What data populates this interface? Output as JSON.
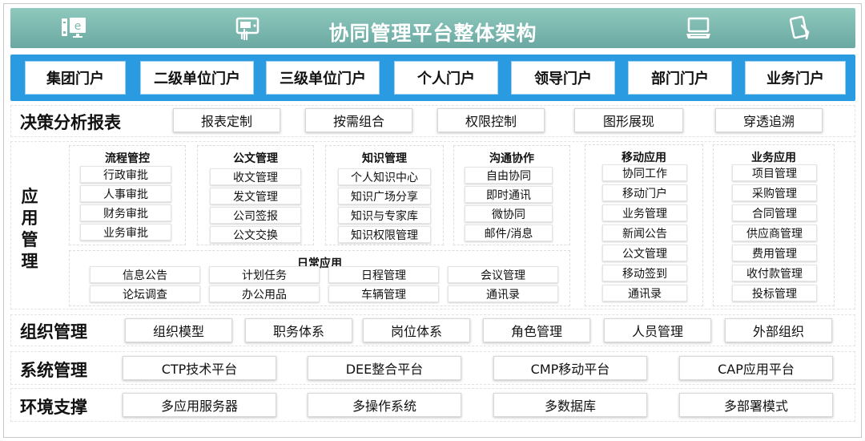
{
  "header": {
    "title": "协同管理平台整体架构",
    "bg_color": "#7db8b0",
    "icons": [
      "computer-e-icon",
      "touch-tablet-icon",
      "laptop-icon",
      "mobile-touch-icon"
    ]
  },
  "portals": {
    "bg_color": "#2a9be0",
    "items": [
      "集团门户",
      "二级单位门户",
      "三级单位门户",
      "个人门户",
      "领导门户",
      "部门门户",
      "业务门户"
    ]
  },
  "decision": {
    "label": "决策分析报表",
    "items": [
      "报表定制",
      "按需组合",
      "权限控制",
      "图形展现",
      "穿透追溯"
    ]
  },
  "apps": {
    "label": [
      "应",
      "用",
      "管",
      "理"
    ],
    "groups": [
      {
        "title": "流程管控",
        "items": [
          "行政审批",
          "人事审批",
          "财务审批",
          "业务审批"
        ]
      },
      {
        "title": "公文管理",
        "items": [
          "收文管理",
          "发文管理",
          "公司签报",
          "公文交换"
        ]
      },
      {
        "title": "知识管理",
        "items": [
          "个人知识中心",
          "知识广场分享",
          "知识与专家库",
          "知识权限管理"
        ]
      },
      {
        "title": "沟通协作",
        "items": [
          "自由协同",
          "即时通讯",
          "微协同",
          "邮件/消息"
        ]
      },
      {
        "title": "移动应用",
        "items": [
          "协同工作",
          "移动门户",
          "业务管理",
          "新闻公告",
          "公文管理",
          "移动签到",
          "通讯录"
        ]
      },
      {
        "title": "业务应用",
        "items": [
          "项目管理",
          "采购管理",
          "合同管理",
          "供应商管理",
          "费用管理",
          "收付款管理",
          "投标管理"
        ]
      }
    ],
    "daily": {
      "title": "日常应用",
      "items": [
        "信息公告",
        "计划任务",
        "日程管理",
        "会议管理",
        "论坛调查",
        "办公用品",
        "车辆管理",
        "通讯录"
      ]
    }
  },
  "org": {
    "label": "组织管理",
    "items": [
      "组织模型",
      "职务体系",
      "岗位体系",
      "角色管理",
      "人员管理",
      "外部组织"
    ]
  },
  "system": {
    "label": "系统管理",
    "items": [
      "CTP技术平台",
      "DEE整合平台",
      "CMP移动平台",
      "CAP应用平台"
    ]
  },
  "env": {
    "label": "环境支撑",
    "items": [
      "多应用服务器",
      "多操作系统",
      "多数据库",
      "多部署模式"
    ]
  }
}
